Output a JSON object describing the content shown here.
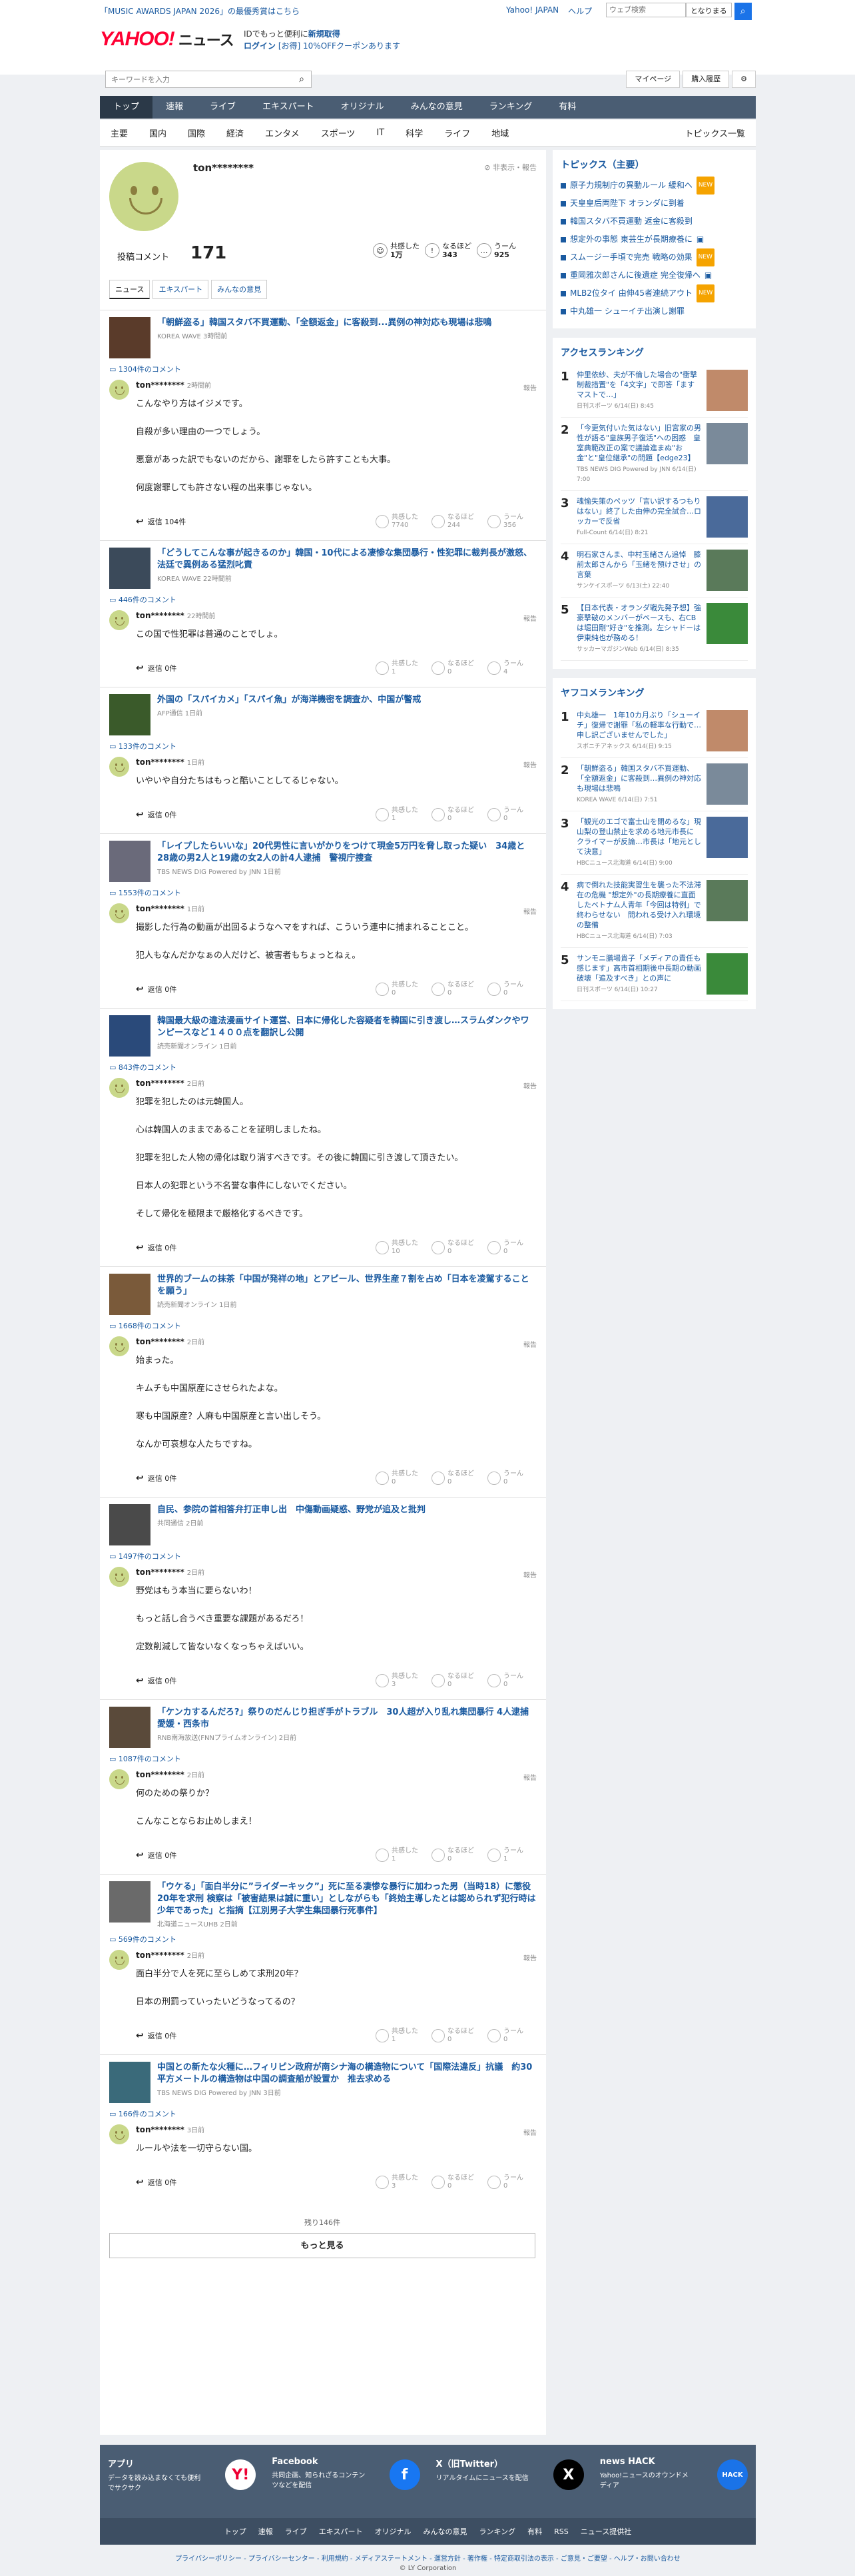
{
  "header": {
    "promo": "「MUSIC AWARDS JAPAN 2026」の最優秀賞はこちら",
    "links": [
      "Yahoo! JAPAN",
      "ヘルプ"
    ],
    "top_search_placeholder": "ウェブ検索",
    "top_search_go": "となりまる",
    "logo": "YAHOO!",
    "logo_sub": "ニュース",
    "login_line1": "IDでもっと便利に",
    "login_line1_bold": "新規取得",
    "login_link": "ログイン",
    "login_line2": "[お得] 10%OFFクーポンあります",
    "keyword_placeholder": "キーワードを入力",
    "btn_mypage": "マイページ",
    "btn_history": "購入履歴"
  },
  "nav": [
    "トップ",
    "速報",
    "ライブ",
    "エキスパート",
    "オリジナル",
    "みんなの意見",
    "ランキング",
    "有料"
  ],
  "subnav": [
    "主要",
    "国内",
    "国際",
    "経済",
    "エンタメ",
    "スポーツ",
    "IT",
    "科学",
    "ライフ",
    "地域"
  ],
  "subnav_all": "トピックス一覧",
  "profile": {
    "name": "ton********",
    "report": "非表示・報告",
    "post_label": "投稿コメント",
    "post_count": "171",
    "reactions": [
      {
        "label": "共感した",
        "value": "1万",
        "icon": "☺"
      },
      {
        "label": "なるほど",
        "value": "343",
        "icon": "!"
      },
      {
        "label": "うーん",
        "value": "925",
        "icon": "…"
      }
    ],
    "tabs": [
      "ニュース",
      "エキスパート",
      "みんなの意見"
    ]
  },
  "items": [
    {
      "title": "「朝鮮盗る」韓国スタバ不買運動、「全額返金」に客殺到...異例の神対応も現場は悲鳴",
      "src": "KOREA WAVE 3時間前",
      "count": "1304件のコメント",
      "user": "ton********",
      "time": "2時間前",
      "paras": [
        "こんなやり方はイジメです。",
        "自殺が多い理由の一つでしょう。",
        "悪意があった訳でもないのだから、謝罪をしたら許すことも大事。",
        "何度謝罪しても許さない程の出来事じゃない。"
      ],
      "reply": "返信 104件",
      "rx": [
        "共感した\n7740",
        "なるほど\n244",
        "うーん\n356"
      ],
      "thumbColor": "#5a3b2a"
    },
    {
      "title": "「どうしてこんな事が起きるのか」韓国・10代による凄惨な集団暴行・性犯罪に裁判長が激怒、法廷で異例ある猛烈叱責",
      "src": "KOREA WAVE 22時間前",
      "count": "446件のコメント",
      "user": "ton********",
      "time": "22時間前",
      "paras": [
        "この国で性犯罪は普通のことでしょ。"
      ],
      "reply": "返信 0件",
      "rx": [
        "共感した\n1",
        "なるほど\n0",
        "うーん\n4"
      ],
      "thumbColor": "#3b4a5a"
    },
    {
      "title": "外国の「スパイカメ」「スパイ魚」が海洋機密を調査か、中国が警戒",
      "src": "AFP通信 1日前",
      "count": "133件のコメント",
      "user": "ton********",
      "time": "1日前",
      "paras": [
        "いやいや自分たちはもっと酷いことしてるじゃない。"
      ],
      "reply": "返信 0件",
      "rx": [
        "共感した\n1",
        "なるほど\n0",
        "うーん\n0"
      ],
      "thumbColor": "#3a5a2a"
    },
    {
      "title": "「レイプしたらいいな」20代男性に言いがかりをつけて現金5万円を脅し取った疑い　34歳と28歳の男2人と19歳の女2人の計4人逮捕　警視庁捜査",
      "src": "TBS NEWS DIG Powered by JNN 1日前",
      "count": "1553件のコメント",
      "user": "ton********",
      "time": "1日前",
      "paras": [
        "撮影した行為の動画が出回るようなヘマをすれば、こういう連中に捕まれることこと。",
        "犯人もなんだかなぁの人だけど、被害者もちょっとねぇ。"
      ],
      "reply": "返信 0件",
      "rx": [
        "共感した\n0",
        "なるほど\n0",
        "うーん\n0"
      ],
      "thumbColor": "#6a6a7a"
    },
    {
      "title": "韓国最大級の違法漫画サイト運営、日本に帰化した容疑者を韓国に引き渡し…スラムダンクやワンピースなど１４００点を翻訳し公開",
      "src": "読売新聞オンライン 1日前",
      "count": "843件のコメント",
      "user": "ton********",
      "time": "2日前",
      "paras": [
        "犯罪を犯したのは元韓国人。",
        "心は韓国人のままであることを証明しましたね。",
        "犯罪を犯した人物の帰化は取り消すべきです。その後に韓国に引き渡して頂きたい。",
        "日本人の犯罪という不名誉な事件にしないでください。",
        "そして帰化を極限まで厳格化するべきです。"
      ],
      "reply": "返信 0件",
      "rx": [
        "共感した\n10",
        "なるほど\n0",
        "うーん\n0"
      ],
      "thumbColor": "#2a4a7a"
    },
    {
      "title": "世界的ブームの抹茶「中国が発祥の地」とアピール、世界生産７割を占め「日本を凌駕することを願う」",
      "src": "読売新聞オンライン 1日前",
      "count": "1668件のコメント",
      "user": "ton********",
      "time": "2日前",
      "paras": [
        "始まった。",
        "キムチも中国原産にさせられたよな。",
        "寒も中国原産？人麻も中国原産と言い出しそう。",
        "なんか可哀想な人たちですね。"
      ],
      "reply": "返信 0件",
      "rx": [
        "共感した\n0",
        "なるほど\n0",
        "うーん\n0"
      ],
      "thumbColor": "#7a5a3a"
    },
    {
      "title": "自民、参院の首相答弁打正申し出　中傷動画疑惑、野党が追及と批判",
      "src": "共同通信 2日前",
      "count": "1497件のコメント",
      "user": "ton********",
      "time": "2日前",
      "paras": [
        "野党はもう本当に要らないわ！",
        "もっと話し合うべき重要な課題があるだろ！",
        "定数削減して皆ないなくなっちゃえばいい。"
      ],
      "reply": "返信 0件",
      "rx": [
        "共感した\n3",
        "なるほど\n0",
        "うーん\n0"
      ],
      "thumbColor": "#4a4a4a"
    },
    {
      "title": "「ケンカするんだろ?」祭りのだんじり担ぎ手がトラブル　30人超が入り乱れ集団暴行 4人逮捕　愛媛・西条市",
      "src": "RNB南海放送(FNNプライムオンライン) 2日前",
      "count": "1087件のコメント",
      "user": "ton********",
      "time": "2日前",
      "paras": [
        "何のための祭りか？",
        "こんなことならお止めしまえ！"
      ],
      "reply": "返信 0件",
      "rx": [
        "共感した\n1",
        "なるほど\n0",
        "うーん\n1"
      ],
      "thumbColor": "#5a4a3a"
    },
    {
      "title": "「ウケる」「面白半分に”ライダーキック”」死に至る凄惨な暴行に加わった男（当時18）に懲役20年を求刑 検察は「被害結果は誠に重い」としながらも「終始主導したとは認められず犯行時は少年であった」と指摘【江別男子大学生集団暴行死事件】",
      "src": "北海道ニュースUHB 2日前",
      "count": "569件のコメント",
      "user": "ton********",
      "time": "2日前",
      "paras": [
        "面白半分で人を死に至らしめて求刑20年？",
        "日本の刑罰っていったいどうなってるの？"
      ],
      "reply": "返信 0件",
      "rx": [
        "共感した\n1",
        "なるほど\n0",
        "うーん\n0"
      ],
      "thumbColor": "#6a6a6a"
    },
    {
      "title": "中国との新たな火種に…フィリピン政府が南シナ海の構造物について「国際法違反」抗議　約30平方メートルの構造物は中国の調査船が設置か　推去求める",
      "src": "TBS NEWS DIG Powered by JNN 3日前",
      "count": "166件のコメント",
      "user": "ton********",
      "time": "3日前",
      "paras": [
        "ルールや法を一切守らない国。"
      ],
      "reply": "返信 0件",
      "rx": [
        "共感した\n3",
        "なるほど\n0",
        "うーん\n0"
      ],
      "thumbColor": "#3a6a7a"
    }
  ],
  "report_label": "報告",
  "more": {
    "rest": "残り146件",
    "button": "もっと見る"
  },
  "side": {
    "topics_title": "トピックス（主要）",
    "topics": [
      {
        "t": "原子力規制庁の異動ルール 緩和へ",
        "tag": "new"
      },
      {
        "t": "天皇皇后両陛下 オランダに到着",
        "tag": ""
      },
      {
        "t": "韓国スタバ不買運動 返金に客殺到",
        "tag": ""
      },
      {
        "t": "想定外の事態 東芸生が長期療養に",
        "tag": "img"
      },
      {
        "t": "スムージー手頃で完売 戦略の効果",
        "tag": "new"
      },
      {
        "t": "重岡雅次郎さんに後遺症 完全復帰へ",
        "tag": "img"
      },
      {
        "t": "MLB2位タイ 由伸45者連続アウト",
        "tag": "new"
      },
      {
        "t": "中丸雄一 シューイチ出演し謝罪",
        "tag": ""
      }
    ],
    "access_title": "アクセスランキング",
    "access": [
      {
        "n": "1",
        "t": "仲里依紗、夫が不倫した場合の\"衝撃制裁措置\"を「4文字」で即答「ますマストで…」",
        "s": "日刊スポーツ 6/14(日) 8:45"
      },
      {
        "n": "2",
        "t": "「今更気付いた気はない」旧宮家の男性が語る\"皇族男子復活\"への困惑　皇室典範改正の案で議論進まぬ\"お金\"と\"皇位継承\"の問題【edge23】",
        "s": "TBS NEWS DIG Powered by JNN 6/14(日) 7:00"
      },
      {
        "n": "3",
        "t": "魂愉失策のペッツ「言い訳するつもりはない」終了した由伸の完全試合…ロッカーで反省",
        "s": "Full-Count 6/14(日) 8:21"
      },
      {
        "n": "4",
        "t": "明石家さんま、中村玉緒さん追悼　膝前太郎さんから「玉緒を預けさせ」の言葉",
        "s": "サンケイスポーツ 6/13(土) 22:40"
      },
      {
        "n": "5",
        "t": "【日本代表・オランダ戦先発予想】強豪撃破のメンバーがベースも、右CBは堀田剛\"好き\"を推測。左シャドーは伊東純也が務める！",
        "s": "サッカーマガジンWeb 6/14(日) 8:35"
      }
    ],
    "yafuco_title": "ヤフコメランキング",
    "yafuco": [
      {
        "n": "1",
        "t": "中丸雄一　1年10カ月ぶり「シューイチ」復帰で謝罪「私の軽率な行動で…申し訳ございませんでした」",
        "s": "スポニチアネックス 6/14(日) 9:15"
      },
      {
        "n": "2",
        "t": "「朝鮮盗る」韓国スタバ不買運動、「全額返金」に客殺到…異例の神対応も現場は悲鳴",
        "s": "KOREA WAVE 6/14(日) 7:51"
      },
      {
        "n": "3",
        "t": "「観光のエゴで富士山を閉めるな」現山梨の登山禁止を求める地元市長に クライマーが反論…市長は「地元として決意」",
        "s": "HBCニュース北海道 6/14(日) 9:00"
      },
      {
        "n": "4",
        "t": "病で倒れた技能実習生を襲った不法滞在の危機 \"想定外\"の長期療養に直面したベトナム人青年「今回は特例」で終わらせない　問われる受け入れ環境の整備",
        "s": "HBCニュース北海道 6/14(日) 7:03"
      },
      {
        "n": "5",
        "t": "サンモニ膳場貴子「メディアの責任も感じます」高市首相期後中長期の動画破壊「追及すべき」との声に",
        "s": "日刊スポーツ 6/14(日) 10:27"
      }
    ]
  },
  "footer": {
    "apps": [
      {
        "name": "アプリ",
        "desc": "データを読み込まなくても便利でサクサク",
        "icon": "Y!"
      },
      {
        "name": "Facebook",
        "desc": "共同企画、知られざるコンテンツなどを配信",
        "icon": "f"
      },
      {
        "name": "X（旧Twitter）",
        "desc": "リアルタイムにニュースを配信",
        "icon": "X"
      },
      {
        "name": "news HACK",
        "desc": "Yahoo!ニュースのオウンドメディア",
        "icon": "HACK"
      }
    ],
    "links": [
      "トップ",
      "速報",
      "ライブ",
      "エキスパート",
      "オリジナル",
      "みんなの意見",
      "ランキング",
      "有料",
      "RSS",
      "ニュース提供社"
    ],
    "legal": "プライバシーポリシー - プライバシーセンター - 利用規約 - メディアステートメント - 運営方針 - 著作権 - 特定商取引法の表示 - ご意見・ご要望 - ヘルプ・お問い合わせ",
    "copyright": "© LY Corporation"
  },
  "colors": {
    "brand_red": "#ff0033",
    "link_blue": "#1a5aa0",
    "nav_bg": "#4a5d73"
  }
}
